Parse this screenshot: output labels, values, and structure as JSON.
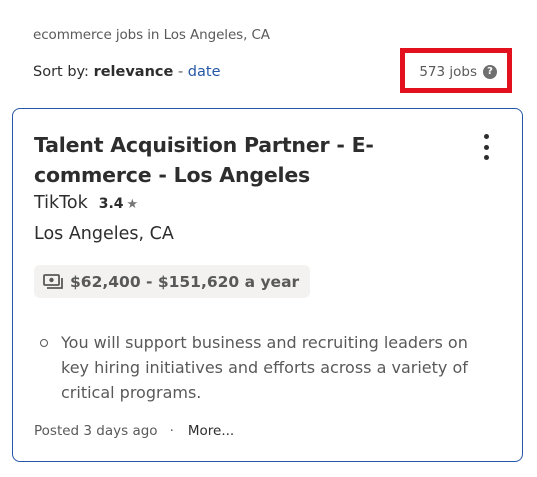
{
  "search_context": "ecommerce jobs in Los Angeles, CA",
  "sort": {
    "label": "Sort by:",
    "active": "relevance",
    "separator": "-",
    "alternate": "date"
  },
  "job_count": {
    "text": "573 jobs",
    "help_icon": "question-mark-circle-icon",
    "help_glyph": "?"
  },
  "highlight_color": "#e3101e",
  "job_card": {
    "title": "Talent Acquisition Partner - E-commerce - Los Angeles",
    "menu_icon": "kebab-menu-icon",
    "company": "TikTok",
    "rating": "3.4",
    "rating_icon": "star-icon",
    "rating_glyph": "★",
    "location": "Los Angeles, CA",
    "salary": {
      "icon": "money-icon",
      "text": "$62,400 - $151,620 a year"
    },
    "snippet": [
      "You will support business and recruiting leaders on key hiring initiatives and efforts across a variety of critical programs."
    ],
    "posted": "Posted 3 days ago",
    "footer_separator": "·",
    "more_link": "More..."
  },
  "colors": {
    "link": "#2557a7",
    "card_border": "#2557a7",
    "text_primary": "#2d2d2d",
    "text_secondary": "#595959",
    "chip_background": "#f3f2f1"
  }
}
